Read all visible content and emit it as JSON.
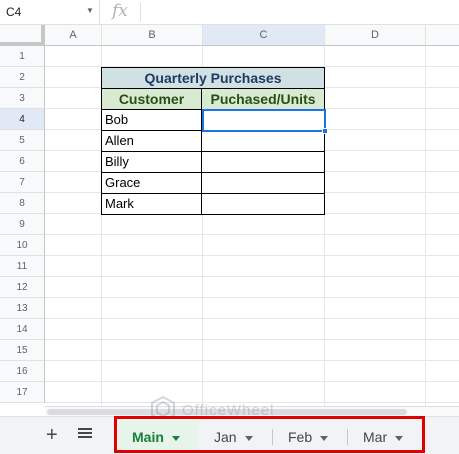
{
  "formula_bar": {
    "name_box": "C4",
    "fx_label": "fx"
  },
  "columns": [
    "A",
    "B",
    "C",
    "D"
  ],
  "rows": [
    "1",
    "2",
    "3",
    "4",
    "5",
    "6",
    "7",
    "8",
    "9",
    "10",
    "11",
    "12",
    "13",
    "14",
    "15",
    "16",
    "17"
  ],
  "active_cell": "C4",
  "table": {
    "title": "Quarterly Purchases",
    "headers": [
      "Customer",
      "Puchased/Units"
    ],
    "customers": [
      "Bob",
      "Allen",
      "Billy",
      "Grace",
      "Mark"
    ]
  },
  "sheet_tabs": [
    {
      "label": "Main",
      "active": true
    },
    {
      "label": "Jan",
      "active": false
    },
    {
      "label": "Feb",
      "active": false
    },
    {
      "label": "Mar",
      "active": false
    }
  ],
  "tabbar": {
    "add_sheet_label": "+"
  },
  "watermark": {
    "text": "OfficeWheel"
  },
  "colors": {
    "title_fill": "#d0e0e3",
    "header_fill": "#d9ead3",
    "active_tab": "#188038",
    "selection": "#1a73e8",
    "highlight": "#e00000"
  },
  "icons": [
    "chevron-down-icon",
    "fx-icon",
    "add-sheet-icon",
    "all-sheets-icon",
    "tab-menu-caret-icon",
    "officewheel-logo-icon"
  ]
}
